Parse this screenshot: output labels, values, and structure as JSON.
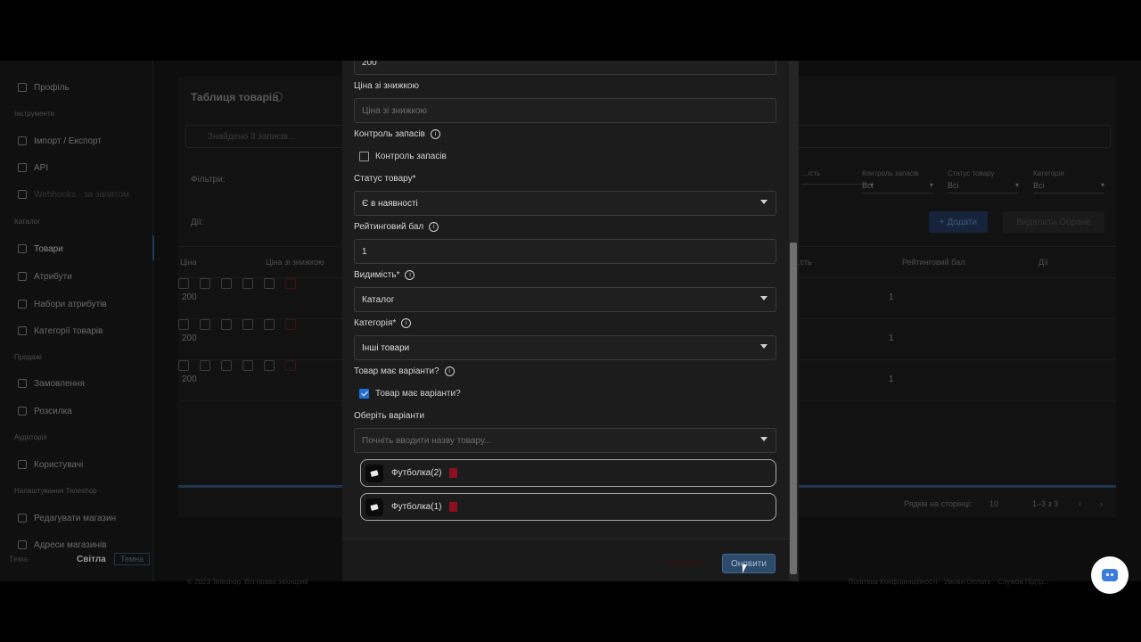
{
  "sidebar": {
    "profile": "Профіль",
    "sec_tools": "Інструменти",
    "import_export": "Імпорт / Експорт",
    "api": "API",
    "webhooks": "Webhooks - за запитом",
    "sec_catalog": "Каталог",
    "products": "Товари",
    "attributes": "Атрибути",
    "attribute_sets": "Набори атрибутів",
    "categories": "Категорії товарів",
    "sec_sales": "Продажі",
    "orders": "Замовлення",
    "mailing": "Розсилка",
    "sec_audience": "Аудиторія",
    "users": "Користувачі",
    "sec_settings": "Налаштування Телеshop",
    "edit_store": "Редагувати магазин",
    "store_addresses": "Адреси магазинів",
    "theme_label": "Тема",
    "theme_light": "Світла",
    "theme_dark": "Темна"
  },
  "main": {
    "title": "Таблиця товарів",
    "search_placeholder": "Знайдено 3 записів...",
    "filters_label": "Фільтри:",
    "actions_label": "Дії:",
    "filters": [
      {
        "label": "...ість",
        "value": ""
      },
      {
        "label": "Контроль запасів",
        "value": "Всі"
      },
      {
        "label": "Статус товару",
        "value": "Всі"
      },
      {
        "label": "Категорія",
        "value": "Всі"
      }
    ],
    "add_button": "+ Додати",
    "delete_button": "Видалити Обране",
    "columns": [
      "Ціна",
      "Ціна зі знижкою",
      "...сть",
      "Рейтинговий бал",
      "Дії"
    ],
    "rows": [
      {
        "price": "200",
        "rating": "1"
      },
      {
        "price": "200",
        "rating": "1"
      },
      {
        "price": "200",
        "rating": "1"
      }
    ],
    "rows_per_page_label": "Рядків на сторінці:",
    "rows_per_page": "10",
    "range": "1–3 з 3"
  },
  "footer": {
    "left": "© 2023 Teleshop. Всі права захищені",
    "right": "Політика Конфіденційності · Умови Оплати · Служба Підтр..."
  },
  "modal": {
    "price_value": "200",
    "discount_label": "Ціна зі знижкою",
    "discount_placeholder": "Ціна зі знижкою",
    "stock_control_label": "Контроль запасів",
    "stock_control_checkbox": "Контроль запасів",
    "status_label": "Статус товару*",
    "status_value": "Є в наявності",
    "rating_label": "Рейтинговий бал",
    "rating_value": "1",
    "visibility_label": "Видимість*",
    "visibility_value": "Каталог",
    "category_label": "Категорія*",
    "category_value": "Інші товари",
    "has_variants_label": "Товар має варіанти?",
    "has_variants_checkbox": "Товар має варіанти?",
    "choose_variants_label": "Оберіть варіанти",
    "variants_placeholder": "Почніть вводити назву товару...",
    "variants": [
      "Футболка(2)",
      "Футболка(1)"
    ],
    "cancel_button": "Скасувати",
    "update_button": "Оновити"
  },
  "colors": {
    "accent": "#1e6fd8",
    "danger": "#8e1020",
    "modal_bg": "#1c1c1c"
  }
}
